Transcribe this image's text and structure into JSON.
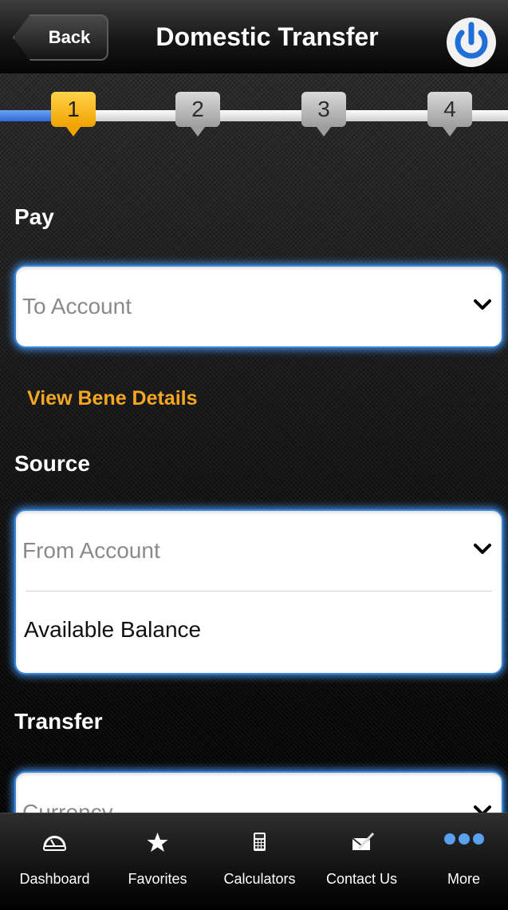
{
  "header": {
    "back_label": "Back",
    "title": "Domestic Transfer",
    "logout_icon": "power-icon"
  },
  "stepper": {
    "steps": [
      "1",
      "2",
      "3",
      "4"
    ],
    "current_step": 1,
    "active_color": "#f7b500"
  },
  "pay": {
    "label": "Pay",
    "to_account_placeholder": "To Account",
    "view_bene_link": "View Bene Details"
  },
  "source": {
    "label": "Source",
    "from_account_placeholder": "From Account",
    "available_balance_label": "Available Balance"
  },
  "transfer": {
    "label": "Transfer",
    "currency_placeholder": "Currency"
  },
  "tabbar": {
    "items": [
      {
        "label": "Dashboard",
        "icon": "dashboard-icon"
      },
      {
        "label": "Favorites",
        "icon": "star-icon"
      },
      {
        "label": "Calculators",
        "icon": "calculator-icon"
      },
      {
        "label": "Contact Us",
        "icon": "contact-icon"
      },
      {
        "label": "More",
        "icon": "more-icon"
      }
    ]
  },
  "colors": {
    "accent_blue": "#3f8fe6",
    "link_orange": "#f5a623"
  }
}
